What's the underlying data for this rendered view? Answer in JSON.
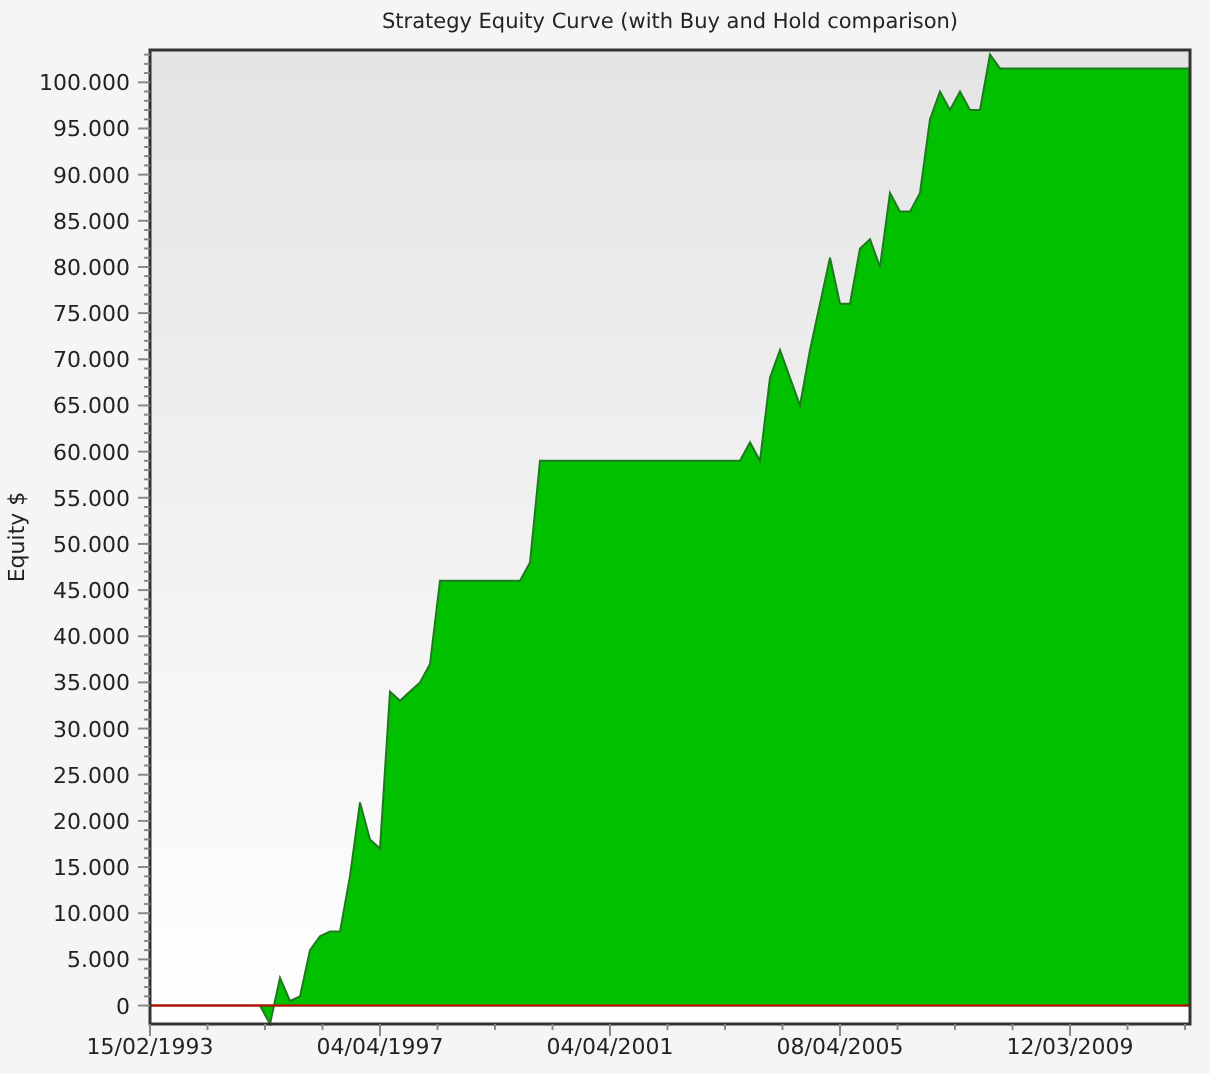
{
  "chart": {
    "chart_data": {
      "type": "area",
      "title": "Strategy Equity Curve (with Buy and Hold comparison)",
      "ylabel": "Equity $",
      "categories": [
        "15/02/1993",
        null,
        null,
        null,
        null,
        null,
        null,
        null,
        null,
        null,
        null,
        null,
        null,
        null,
        null,
        null,
        null,
        null,
        null,
        null,
        null,
        null,
        null,
        "04/04/1997",
        null,
        null,
        null,
        null,
        null,
        null,
        null,
        null,
        null,
        null,
        null,
        null,
        null,
        null,
        null,
        null,
        null,
        null,
        null,
        null,
        null,
        null,
        "04/04/2001",
        null,
        null,
        null,
        null,
        null,
        null,
        null,
        null,
        null,
        null,
        null,
        null,
        null,
        null,
        null,
        null,
        null,
        null,
        null,
        null,
        null,
        null,
        "08/04/2005",
        null,
        null,
        null,
        null,
        null,
        null,
        null,
        null,
        null,
        null,
        null,
        null,
        null,
        null,
        null,
        null,
        null,
        null,
        null,
        null,
        null,
        null,
        "12/03/2009",
        null,
        null,
        null,
        null,
        null,
        null,
        null,
        null,
        null,
        null,
        null,
        null
      ],
      "series": [
        {
          "color": "#00c000",
          "values": [
            0,
            0,
            0,
            0,
            0,
            0,
            0,
            0,
            0,
            0,
            0,
            0,
            -2000,
            3000,
            500,
            1000,
            6000,
            7500,
            8000,
            8000,
            14000,
            22000,
            18000,
            17000,
            34000,
            33000,
            34000,
            35000,
            37000,
            46000,
            46000,
            46000,
            46000,
            46000,
            46000,
            46000,
            46000,
            46000,
            48000,
            59000,
            59000,
            59000,
            59000,
            59000,
            59000,
            59000,
            59000,
            59000,
            59000,
            59000,
            59000,
            59000,
            59000,
            59000,
            59000,
            59000,
            59000,
            59000,
            59000,
            59000,
            61000,
            59000,
            68000,
            71000,
            68000,
            65000,
            71000,
            76000,
            81000,
            76000,
            76000,
            82000,
            83000,
            80000,
            88000,
            86000,
            86000,
            88000,
            96000,
            99000,
            97000,
            99000,
            97000,
            97000,
            103000,
            101500,
            101500,
            101500,
            101500,
            101500,
            101500,
            101500,
            101500,
            101500,
            101500,
            101500,
            101500,
            101500,
            101500,
            101500,
            101500,
            101500,
            101500,
            101500,
            101500
          ]
        }
      ],
      "ref_lines": [
        {
          "axis": "y",
          "value": 0,
          "color": "#cc0000"
        }
      ],
      "ylim": [
        -2000,
        103500
      ],
      "yticks": [
        {
          "value": 0,
          "label": "0"
        },
        {
          "value": 5000,
          "label": "5.000"
        },
        {
          "value": 10000,
          "label": "10.000"
        },
        {
          "value": 15000,
          "label": "15.000"
        },
        {
          "value": 20000,
          "label": "20.000"
        },
        {
          "value": 25000,
          "label": "25.000"
        },
        {
          "value": 30000,
          "label": "30.000"
        },
        {
          "value": 35000,
          "label": "35.000"
        },
        {
          "value": 40000,
          "label": "40.000"
        },
        {
          "value": 45000,
          "label": "45.000"
        },
        {
          "value": 50000,
          "label": "50.000"
        },
        {
          "value": 55000,
          "label": "55.000"
        },
        {
          "value": 60000,
          "label": "60.000"
        },
        {
          "value": 65000,
          "label": "65.000"
        },
        {
          "value": 70000,
          "label": "70.000"
        },
        {
          "value": 75000,
          "label": "75.000"
        },
        {
          "value": 80000,
          "label": "80.000"
        },
        {
          "value": 85000,
          "label": "85.000"
        },
        {
          "value": 90000,
          "label": "90.000"
        },
        {
          "value": 95000,
          "label": "95.000"
        },
        {
          "value": 100000,
          "label": "100.000"
        }
      ]
    }
  }
}
